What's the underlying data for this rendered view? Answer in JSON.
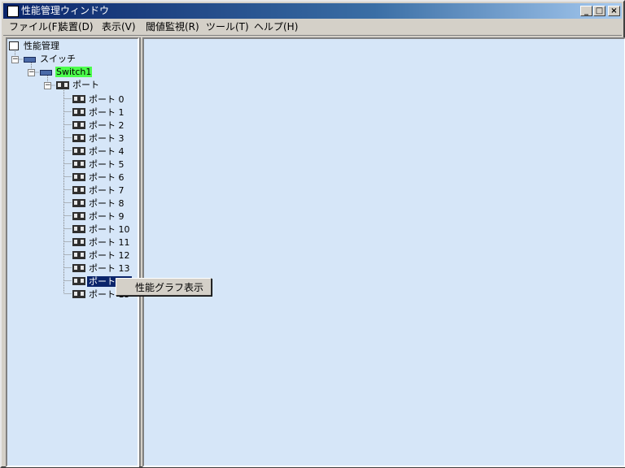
{
  "window": {
    "title": "性能管理ウィンドウ"
  },
  "menu": [
    "ファイル(F)",
    "装置(D)",
    "表示(V)",
    "閾値監視(R)",
    "ツール(T)",
    "ヘルプ(H)"
  ],
  "tree": {
    "root": "性能管理",
    "category": "スイッチ",
    "device": "Switch1",
    "group": "ポート",
    "ports": [
      "ポート 0",
      "ポート 1",
      "ポート 2",
      "ポート 3",
      "ポート 4",
      "ポート 5",
      "ポート 6",
      "ポート 7",
      "ポート 8",
      "ポート 9",
      "ポート 10",
      "ポート 11",
      "ポート 12",
      "ポート 13",
      "ポート 14",
      "ポート 15"
    ],
    "selected_index": 14
  },
  "context_menu": {
    "item": "性能グラフ表示"
  },
  "colors": {
    "pane_bg": "#d6e6f8",
    "selection": "#0a246a",
    "device_highlight": "#4cff4c"
  }
}
